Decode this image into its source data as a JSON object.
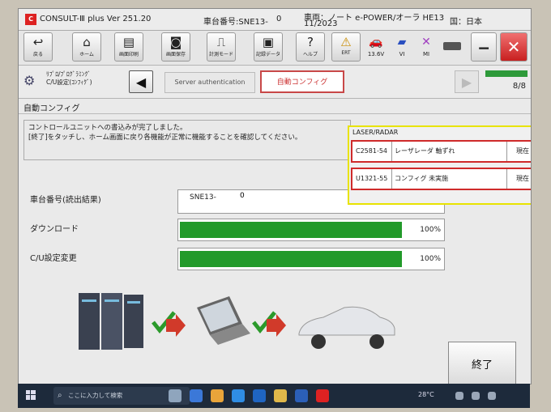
{
  "app": {
    "title": "CONSULT-Ⅲ plus Ver 251.20",
    "vin_label": "車台番号:SNE13-",
    "vin_suffix": "0",
    "vehicle_line1": "車両：ノート e-POWER/オーラ HE13",
    "vehicle_line2": "11/2023",
    "country": "国：日本"
  },
  "toolbar": {
    "buttons": [
      {
        "label": "戻る",
        "icon": "back-icon"
      },
      {
        "label": "ホーム",
        "icon": "home-icon"
      },
      {
        "label": "画面印刷",
        "icon": "print-icon"
      },
      {
        "label": "画面保存",
        "icon": "camera-icon"
      },
      {
        "label": "計測モード",
        "icon": "measure-icon"
      },
      {
        "label": "記録データ",
        "icon": "record-data-icon"
      },
      {
        "label": "ヘルプ",
        "icon": "help-icon"
      },
      {
        "label": "ERT",
        "icon": "warning-icon"
      }
    ],
    "status": [
      {
        "label": "13.6V",
        "icon": "car-battery-icon"
      },
      {
        "label": "VI",
        "icon": "vi-icon"
      },
      {
        "label": "MI",
        "icon": "mi-icon"
      }
    ]
  },
  "breadcrumb": {
    "system_line1": "ﾘﾌﾟﾛ/ﾌﾟﾛｸﾞﾗﾐﾝｸﾞ",
    "system_line2": "C/U設定(ｺﾝﾌｨｸﾞ)",
    "step_auth": "Server authentication",
    "step_auto": "自動コンフィグ",
    "page": "8/8"
  },
  "main": {
    "section_title": "自動コンフィグ",
    "message_line1": "コントロールユニットへの書込みが完了しました。",
    "message_line2": "[終了]をタッチし、ホーム画面に戻り各機能が正常に機能することを確認してください。",
    "vin_row_label": "車台番号(読出結果)",
    "vin_row_value": "SNE13-",
    "vin_row_suffix": "0",
    "download_label": "ダウンロード",
    "download_pct": "100%",
    "download_progress": 100,
    "cu_label": "C/U設定変更",
    "cu_pct": "100%",
    "cu_progress": 100,
    "end_button": "終了"
  },
  "dtc_panel": {
    "title": "LASER/RADAR",
    "rows": [
      {
        "code": "C2581-54",
        "desc": "レーザレーダ 軸ずれ",
        "status": "現在"
      },
      {
        "code": "U1321-55",
        "desc": "コンフィグ 未実施",
        "status": "現在"
      }
    ]
  },
  "taskbar": {
    "search_placeholder": "ここに入力して検索",
    "temperature": "28°C"
  },
  "colors": {
    "progress_green": "#229a2a",
    "highlight_yellow": "#e8e300",
    "dtc_red": "#cf2a2a",
    "active_step": "#c84848"
  }
}
